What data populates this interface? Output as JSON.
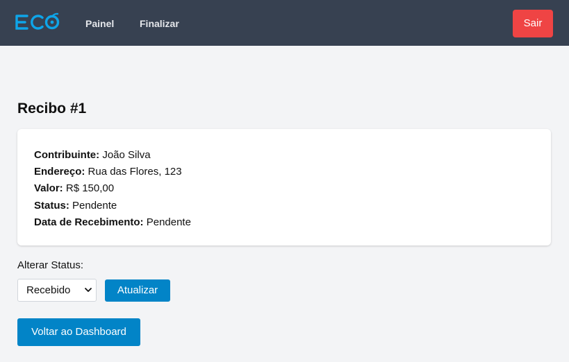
{
  "navbar": {
    "logo_text": "ECO",
    "links": [
      "Painel",
      "Finalizar"
    ],
    "logout_label": "Sair"
  },
  "page": {
    "title": "Recibo #1"
  },
  "receipt": {
    "fields": [
      {
        "label": "Contribuinte:",
        "value": "João Silva"
      },
      {
        "label": "Endereço:",
        "value": "Rua das Flores, 123"
      },
      {
        "label": "Valor:",
        "value": "R$ 150,00"
      },
      {
        "label": "Status:",
        "value": "Pendente"
      },
      {
        "label": "Data de Recebimento:",
        "value": "Pendente"
      }
    ]
  },
  "status_form": {
    "label": "Alterar Status:",
    "selected": "Recebido",
    "submit_label": "Atualizar"
  },
  "back_button": "Voltar ao Dashboard",
  "colors": {
    "navbar_bg": "#374151",
    "logo": "#0ea5e9",
    "danger": "#ef4444",
    "primary": "#0284c7",
    "page_bg": "#f3f4f6"
  }
}
